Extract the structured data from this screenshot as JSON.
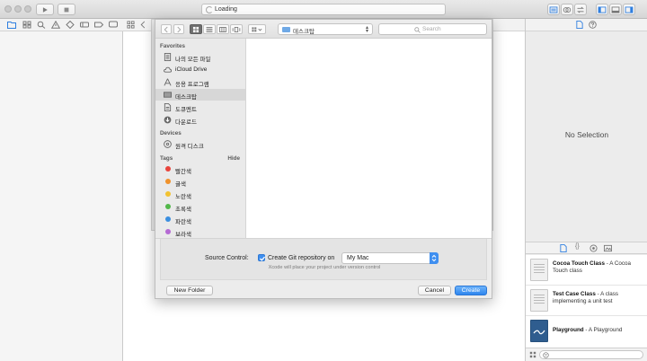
{
  "toolbar": {
    "activity_text": "Loading"
  },
  "dialog": {
    "location": "데스크탑",
    "search_placeholder": "Search",
    "sidebar": {
      "favorites_header": "Favorites",
      "favorites": [
        {
          "label": "나의 모든 파일",
          "icon": "all-files-icon"
        },
        {
          "label": "iCloud Drive",
          "icon": "cloud-icon"
        },
        {
          "label": "응용 프로그램",
          "icon": "applications-icon"
        },
        {
          "label": "데스크탑",
          "icon": "desktop-icon",
          "selected": true
        },
        {
          "label": "도큐멘트",
          "icon": "documents-icon"
        },
        {
          "label": "다운로드",
          "icon": "downloads-icon"
        }
      ],
      "devices_header": "Devices",
      "devices": [
        {
          "label": "원격 디스크",
          "icon": "disc-icon"
        }
      ],
      "tags_header": "Tags",
      "tags_hide": "Hide",
      "tags": [
        {
          "label": "빨간색",
          "color": "#e9443c"
        },
        {
          "label": "귤색",
          "color": "#f0922c"
        },
        {
          "label": "노란색",
          "color": "#f2c230"
        },
        {
          "label": "초록색",
          "color": "#52b84a"
        },
        {
          "label": "파란색",
          "color": "#3b8fe0"
        },
        {
          "label": "보라색",
          "color": "#b56ad4"
        }
      ]
    },
    "source_control": {
      "label": "Source Control:",
      "checkbox_label": "Create Git repository on",
      "checked": true,
      "target": "My Mac",
      "hint": "Xcode will place your project under version control"
    },
    "buttons": {
      "new_folder": "New Folder",
      "cancel": "Cancel",
      "create": "Create"
    }
  },
  "inspector": {
    "no_selection": "No Selection"
  },
  "library": [
    {
      "title": "Cocoa Touch Class",
      "desc": " - A Cocoa Touch class"
    },
    {
      "title": "Test Case Class",
      "desc": " - A class implementing a unit test"
    },
    {
      "title": "Playground",
      "desc": " - A Playground"
    }
  ],
  "colors": {
    "accent": "#3f8ff0",
    "selection": "#d7d7d7"
  }
}
